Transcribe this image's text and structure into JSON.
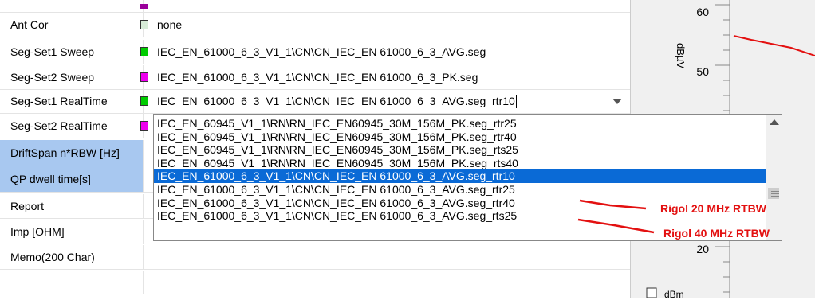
{
  "properties": [
    {
      "label": "Ant Cor",
      "value": "none",
      "swatch": "#d8ecd8"
    },
    {
      "label": "Seg-Set1 Sweep",
      "value": "IEC_EN_61000_6_3_V1_1\\CN\\CN_IEC_EN 61000_6_3_AVG.seg",
      "swatch": "#00cc00"
    },
    {
      "label": "Seg-Set2 Sweep",
      "value": "IEC_EN_61000_6_3_V1_1\\CN\\CN_IEC_EN 61000_6_3_PK.seg",
      "swatch": "#ee00ee"
    },
    {
      "label": "Seg-Set1 RealTime",
      "value": "IEC_EN_61000_6_3_V1_1\\CN\\CN_IEC_EN 61000_6_3_AVG.seg_rtr10",
      "swatch": "#00cc00"
    },
    {
      "label": "Seg-Set2 RealTime",
      "value": "",
      "swatch": "#ee00ee"
    },
    {
      "label": "DriftSpan n*RBW [Hz]",
      "value": ""
    },
    {
      "label": "QP dwell time[s]",
      "value": ""
    },
    {
      "label": "Report",
      "value": ""
    },
    {
      "label": "Imp [OHM]",
      "value": ""
    },
    {
      "label": "Memo(200 Char)",
      "value": ""
    }
  ],
  "dropdown": {
    "items": [
      "IEC_EN_60945_V1_1\\RN\\RN_IEC_EN60945_30M_156M_PK.seg_rtr25",
      "IEC_EN_60945_V1_1\\RN\\RN_IEC_EN60945_30M_156M_PK.seg_rtr40",
      "IEC_EN_60945_V1_1\\RN\\RN_IEC_EN60945_30M_156M_PK.seg_rts25",
      "IEC_EN_60945_V1_1\\RN\\RN_IEC_EN60945_30M_156M_PK.seg_rts40",
      "IEC_EN_61000_6_3_V1_1\\CN\\CN_IEC_EN 61000_6_3_AVG.seg_rtr10",
      "IEC_EN_61000_6_3_V1_1\\CN\\CN_IEC_EN 61000_6_3_AVG.seg_rtr25",
      "IEC_EN_61000_6_3_V1_1\\CN\\CN_IEC_EN 61000_6_3_AVG.seg_rtr40",
      "IEC_EN_61000_6_3_V1_1\\CN\\CN_IEC_EN 61000_6_3_AVG.seg_rts25"
    ],
    "selected_index": 4
  },
  "annotations": {
    "rtbw20": "Rigol 20 MHz RTBW",
    "rtbw40": "Rigol 40 MHz RTBW",
    "color": "#e31010"
  },
  "chart": {
    "ylabel": "dBµV",
    "ticks": [
      "60",
      "50",
      "20"
    ],
    "checkbox_label": "dBm"
  },
  "colors": {
    "selection": "#0a6ad6",
    "label_selected": "#a8c8f0"
  }
}
